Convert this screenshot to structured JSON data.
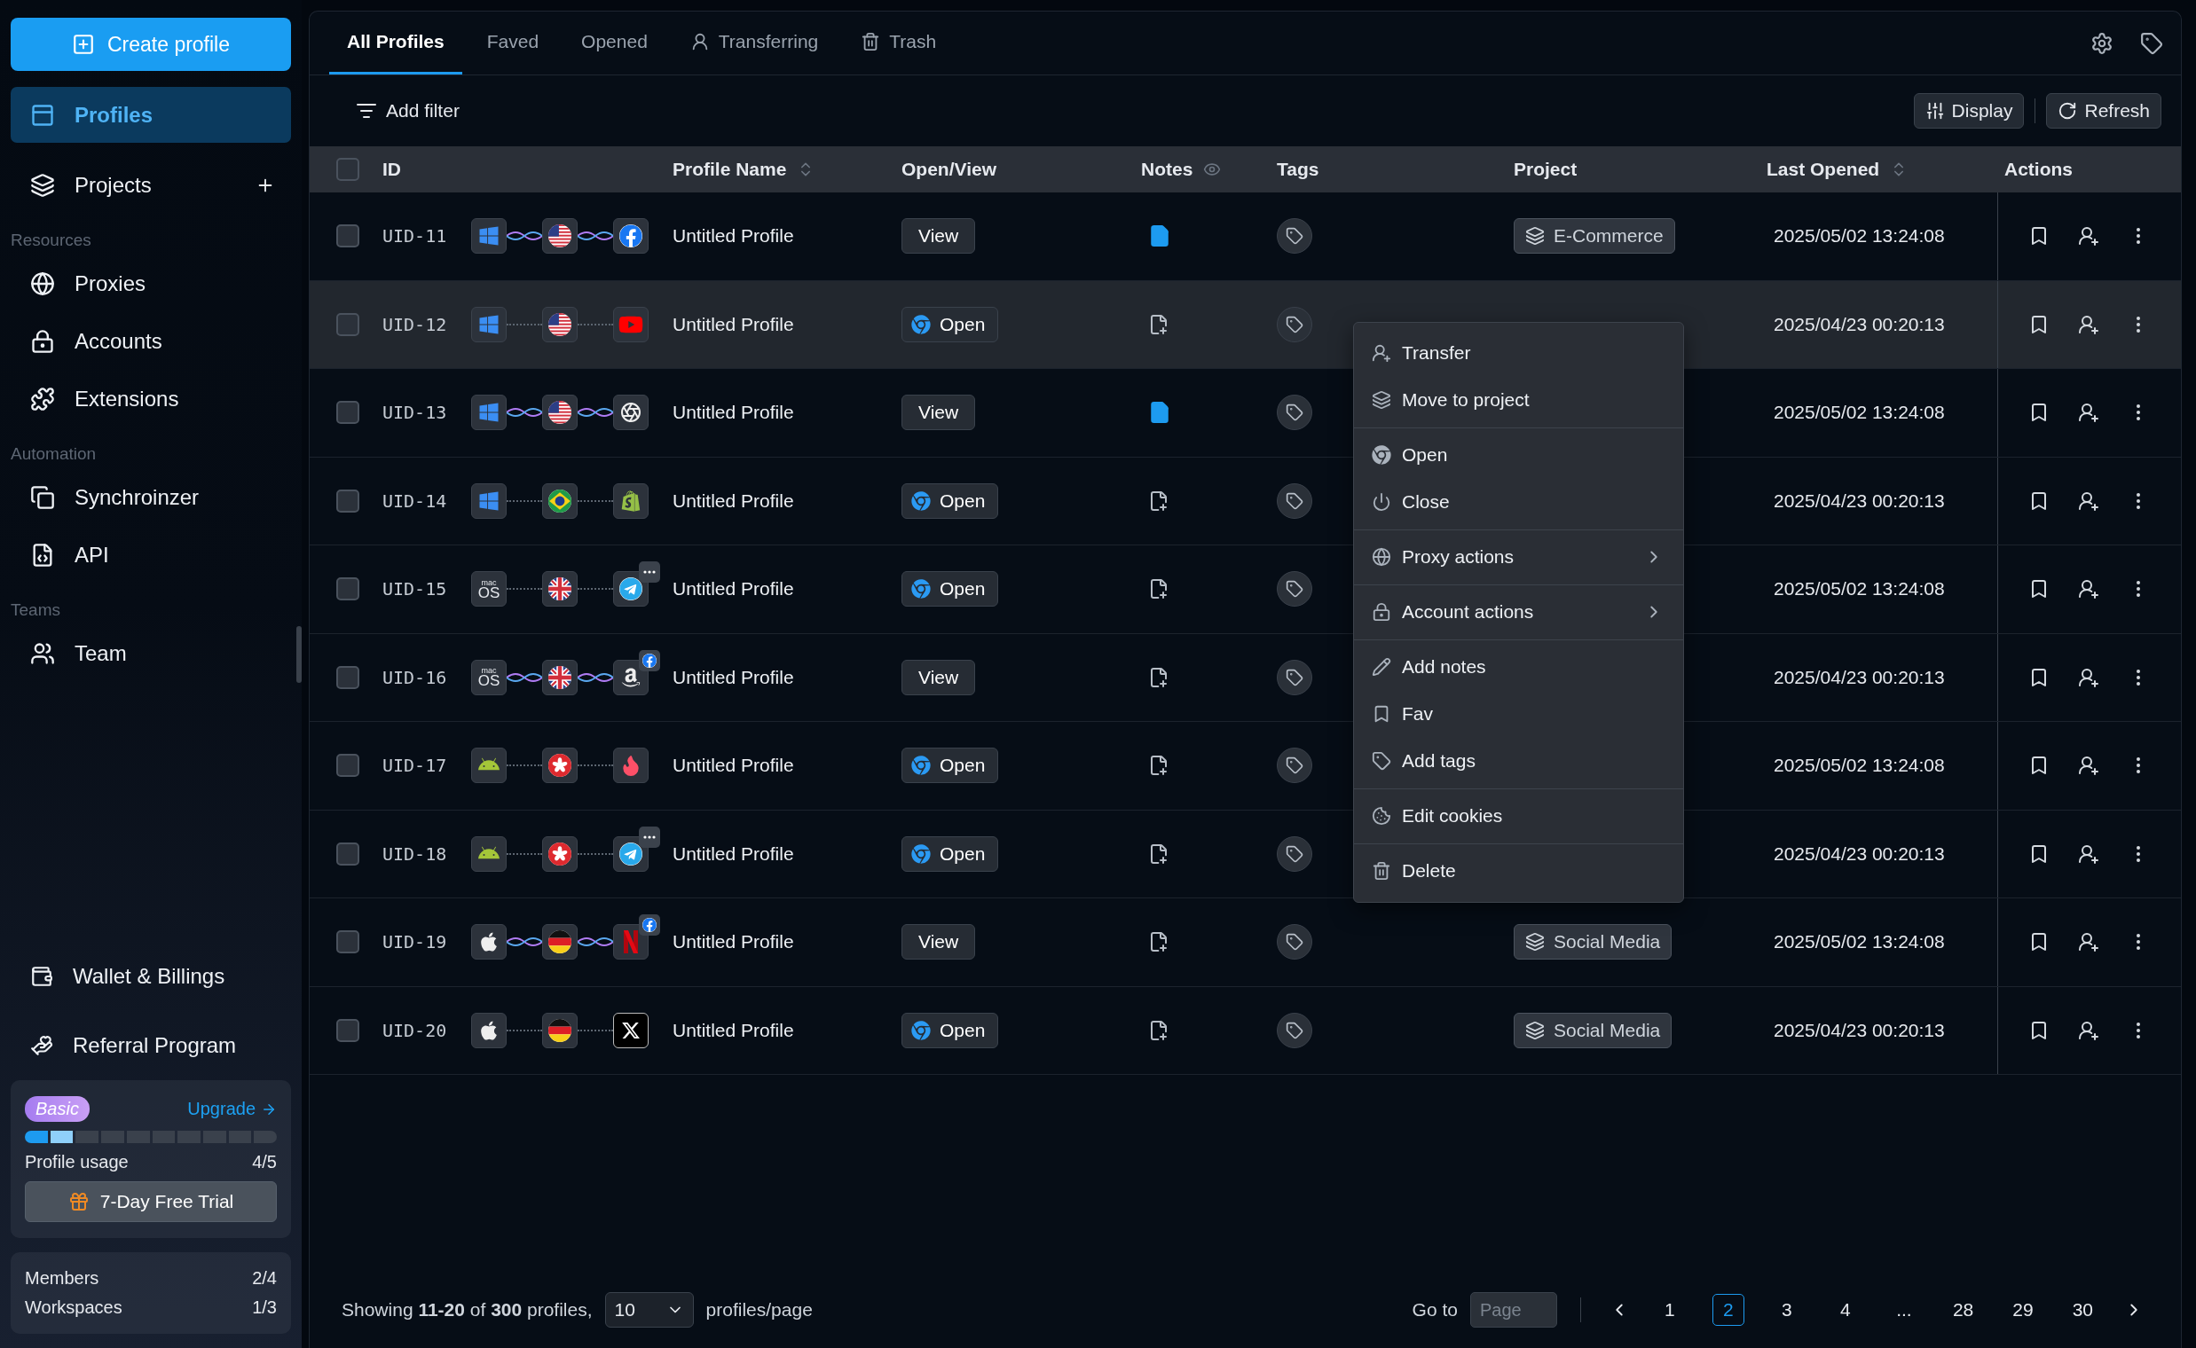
{
  "sidebar": {
    "create_button": "Create profile",
    "sections": [
      {
        "items": [
          {
            "label": "Profiles",
            "selected": true,
            "add": false
          },
          {
            "label": "Projects",
            "selected": false,
            "add": true
          }
        ]
      },
      {
        "title": "Resources",
        "items": [
          {
            "label": "Proxies",
            "selected": false,
            "add": false
          },
          {
            "label": "Accounts",
            "selected": false,
            "add": false
          },
          {
            "label": "Extensions",
            "selected": false,
            "add": false
          }
        ]
      },
      {
        "title": "Automation",
        "items": [
          {
            "label": "Synchroinzer",
            "selected": false,
            "add": false
          },
          {
            "label": "API",
            "selected": false,
            "add": false
          }
        ]
      },
      {
        "title": "Teams",
        "items": [
          {
            "label": "Team",
            "selected": false,
            "add": false
          }
        ]
      }
    ],
    "bottom_items": [
      {
        "label": "Wallet & Billings"
      },
      {
        "label": "Referral Program"
      }
    ],
    "plan": {
      "badge": "Basic",
      "upgrade": "Upgrade",
      "level": 0.2,
      "usage_label": "Profile usage",
      "usage_value": "4/5",
      "trial_button": "7-Day Free Trial"
    },
    "stats": [
      {
        "label": "Members",
        "value": "2/4"
      },
      {
        "label": "Workspaces",
        "value": "1/3"
      }
    ]
  },
  "tabs": [
    {
      "label": "All Profiles",
      "selected": true
    },
    {
      "label": "Faved",
      "selected": false
    },
    {
      "label": "Opened",
      "selected": false
    },
    {
      "label": "Transferring",
      "selected": false
    },
    {
      "label": "Trash",
      "selected": false
    }
  ],
  "toolbar": {
    "filter": "Add filter",
    "display": "Display",
    "refresh": "Refresh"
  },
  "table": {
    "select_all": {
      "checked": false
    },
    "columns": [
      "ID",
      "Profile Name",
      "Open/View",
      "Notes",
      "Tags",
      "Project",
      "Last Opened",
      "Actions"
    ],
    "rows": [
      {
        "id": "UID-11",
        "checked": false,
        "selected": false,
        "chain": [
          {
            "kind": "windows"
          },
          {
            "kind": "us"
          },
          {
            "kind": "facebook"
          }
        ],
        "connector": {
          "kind": "wave"
        },
        "name": "Untitled Profile",
        "button": {
          "kind": "view",
          "label": "View"
        },
        "has_note": true,
        "project": "E-Commerce",
        "last_opened": "2025/05/02 13:24:08"
      },
      {
        "id": "UID-12",
        "checked": false,
        "selected": true,
        "chain": [
          {
            "kind": "windows"
          },
          {
            "kind": "us"
          },
          {
            "kind": "youtube"
          }
        ],
        "connector": {
          "kind": "dotted"
        },
        "name": "Untitled Profile",
        "button": {
          "kind": "open",
          "label": "Open"
        },
        "has_note": false,
        "last_opened": "2025/04/23 00:20:13"
      },
      {
        "id": "UID-13",
        "checked": false,
        "selected": false,
        "chain": [
          {
            "kind": "windows"
          },
          {
            "kind": "us"
          },
          {
            "kind": "openai"
          }
        ],
        "connector": {
          "kind": "wave"
        },
        "name": "Untitled Profile",
        "button": {
          "kind": "view",
          "label": "View"
        },
        "has_note": true,
        "last_opened": "2025/05/02 13:24:08"
      },
      {
        "id": "UID-14",
        "checked": false,
        "selected": false,
        "chain": [
          {
            "kind": "windows"
          },
          {
            "kind": "br"
          },
          {
            "kind": "shopify"
          }
        ],
        "connector": {
          "kind": "dotted"
        },
        "name": "Untitled Profile",
        "button": {
          "kind": "open",
          "label": "Open"
        },
        "has_note": false,
        "last_opened": "2025/04/23 00:20:13"
      },
      {
        "id": "UID-15",
        "checked": false,
        "selected": false,
        "chain": [
          {
            "kind": "macos",
            "text": [
              "mac",
              "OS"
            ]
          },
          {
            "kind": "gb"
          },
          {
            "kind": "telegram"
          }
        ],
        "badge": {
          "kind": "more"
        },
        "connector": {
          "kind": "dotted"
        },
        "name": "Untitled Profile",
        "button": {
          "kind": "open",
          "label": "Open"
        },
        "has_note": false,
        "last_opened": "2025/05/02 13:24:08"
      },
      {
        "id": "UID-16",
        "checked": false,
        "selected": false,
        "chain": [
          {
            "kind": "macos",
            "text": [
              "mac",
              "OS"
            ]
          },
          {
            "kind": "gb"
          },
          {
            "kind": "amazon"
          }
        ],
        "badge": {
          "kind": "facebook"
        },
        "connector": {
          "kind": "wave"
        },
        "name": "Untitled Profile",
        "button": {
          "kind": "view",
          "label": "View"
        },
        "has_note": false,
        "last_opened": "2025/04/23 00:20:13"
      },
      {
        "id": "UID-17",
        "checked": false,
        "selected": false,
        "chain": [
          {
            "kind": "android"
          },
          {
            "kind": "hk"
          },
          {
            "kind": "tinder"
          }
        ],
        "connector": {
          "kind": "dotted"
        },
        "name": "Untitled Profile",
        "button": {
          "kind": "open",
          "label": "Open"
        },
        "has_note": false,
        "last_opened": "2025/05/02 13:24:08"
      },
      {
        "id": "UID-18",
        "checked": false,
        "selected": false,
        "chain": [
          {
            "kind": "android"
          },
          {
            "kind": "hk"
          },
          {
            "kind": "telegram"
          }
        ],
        "badge": {
          "kind": "more"
        },
        "connector": {
          "kind": "dotted"
        },
        "name": "Untitled Profile",
        "button": {
          "kind": "open",
          "label": "Open"
        },
        "has_note": false,
        "last_opened": "2025/04/23 00:20:13"
      },
      {
        "id": "UID-19",
        "checked": false,
        "selected": false,
        "chain": [
          {
            "kind": "apple"
          },
          {
            "kind": "de"
          },
          {
            "kind": "netflix"
          }
        ],
        "badge": {
          "kind": "facebook"
        },
        "connector": {
          "kind": "wave"
        },
        "name": "Untitled Profile",
        "button": {
          "kind": "view",
          "label": "View"
        },
        "has_note": false,
        "project": "Social Media",
        "last_opened": "2025/05/02 13:24:08"
      },
      {
        "id": "UID-20",
        "checked": false,
        "selected": false,
        "chain": [
          {
            "kind": "apple"
          },
          {
            "kind": "de"
          },
          {
            "kind": "x"
          }
        ],
        "connector": {
          "kind": "dotted"
        },
        "name": "Untitled Profile",
        "button": {
          "kind": "open",
          "label": "Open"
        },
        "has_note": false,
        "project": "Social Media",
        "last_opened": "2025/04/23 00:20:13"
      }
    ]
  },
  "context_menu": {
    "groups": [
      {
        "items": [
          {
            "label": "Transfer",
            "submenu": false
          },
          {
            "label": "Move to project",
            "submenu": false
          }
        ]
      },
      {
        "items": [
          {
            "label": "Open",
            "submenu": false
          },
          {
            "label": "Close",
            "submenu": false
          }
        ]
      },
      {
        "items": [
          {
            "label": "Proxy actions",
            "submenu": true
          }
        ]
      },
      {
        "items": [
          {
            "label": "Account actions",
            "submenu": true
          }
        ]
      },
      {
        "items": [
          {
            "label": "Add notes",
            "submenu": false
          },
          {
            "label": "Fav",
            "submenu": false
          },
          {
            "label": "Add tags",
            "submenu": false
          }
        ]
      },
      {
        "items": [
          {
            "label": "Edit cookies",
            "submenu": false
          }
        ]
      },
      {
        "items": [
          {
            "label": "Delete",
            "submenu": false
          }
        ]
      }
    ]
  },
  "footer": {
    "summary": "Showing **11-20** of **300** profiles,",
    "page_size": "10",
    "page_size_label": "profiles/page",
    "goto_label": "Go to",
    "goto_placeholder": "Page",
    "pages": [
      {
        "label": "1",
        "selected": false
      },
      {
        "label": "2",
        "selected": true
      },
      {
        "label": "3",
        "selected": false
      },
      {
        "label": "4",
        "selected": false
      },
      {
        "label": "...",
        "selected": false
      },
      {
        "label": "28",
        "selected": false
      },
      {
        "label": "29",
        "selected": false
      },
      {
        "label": "30",
        "selected": false
      }
    ]
  }
}
